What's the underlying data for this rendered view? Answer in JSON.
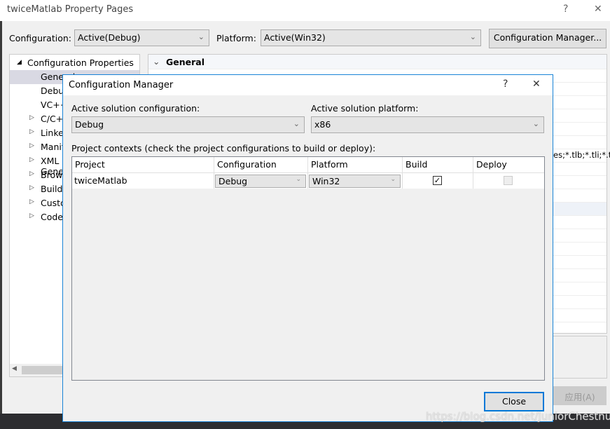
{
  "window": {
    "title": "twiceMatlab Property Pages",
    "help": "?",
    "close": "✕"
  },
  "toolbar": {
    "configuration_label": "Configuration:",
    "configuration_value": "Active(Debug)",
    "platform_label": "Platform:",
    "platform_value": "Active(Win32)",
    "config_manager_button": "Configuration Manager..."
  },
  "tree": {
    "root": "Configuration Properties",
    "items": [
      {
        "label": "General",
        "expandable": false,
        "selected": true
      },
      {
        "label": "Debugging",
        "expandable": false
      },
      {
        "label": "VC++ Directories",
        "expandable": false
      },
      {
        "label": "C/C++",
        "expandable": true
      },
      {
        "label": "Linker",
        "expandable": true
      },
      {
        "label": "Manifest Tool",
        "expandable": true
      },
      {
        "label": "XML Document Generator",
        "expandable": true
      },
      {
        "label": "Browse Information",
        "expandable": true
      },
      {
        "label": "Build Events",
        "expandable": true
      },
      {
        "label": "Custom Build Step",
        "expandable": true
      },
      {
        "label": "Code Analysis",
        "expandable": true
      }
    ]
  },
  "grid": {
    "section": "General",
    "partial_text": "es;*.tlb;*.tli;*.t"
  },
  "apply_button": "应用(A)",
  "dialog": {
    "title": "Configuration Manager",
    "help": "?",
    "close": "✕",
    "active_config_label": "Active solution configuration:",
    "active_config_value": "Debug",
    "active_platform_label": "Active solution platform:",
    "active_platform_value": "x86",
    "contexts_label": "Project contexts (check the project configurations to build or deploy):",
    "columns": [
      "Project",
      "Configuration",
      "Platform",
      "Build",
      "Deploy"
    ],
    "rows": [
      {
        "project": "twiceMatlab",
        "configuration": "Debug",
        "platform": "Win32",
        "build": true,
        "deploy": false
      }
    ],
    "close_button": "Close"
  },
  "watermark": "https://blog.csdn.net/JuniorChestnut",
  "colors": {
    "accent": "#1883d7",
    "selection": "#cce4f7"
  }
}
